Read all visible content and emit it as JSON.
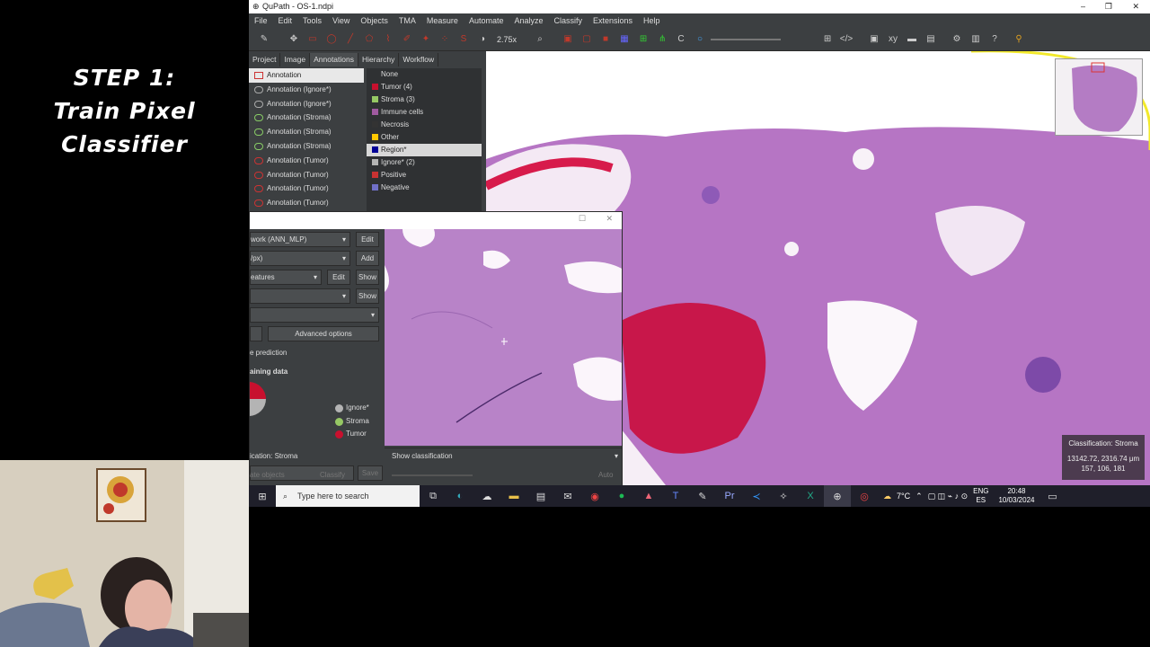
{
  "step": {
    "line1": "STEP 1:",
    "line2": "Train Pixel",
    "line3": "Classifier"
  },
  "window": {
    "title": "QuPath - OS-1.ndpi"
  },
  "menu": [
    "File",
    "Edit",
    "Tools",
    "View",
    "Objects",
    "TMA",
    "Measure",
    "Automate",
    "Analyze",
    "Classify",
    "Extensions",
    "Help"
  ],
  "toolbar": {
    "zoom": "2.75x"
  },
  "tabs": [
    "Project",
    "Image",
    "Annotations",
    "Hierarchy",
    "Workflow"
  ],
  "annotations": [
    "Annotation",
    "Annotation (Ignore*)",
    "Annotation (Ignore*)",
    "Annotation (Stroma)",
    "Annotation (Stroma)",
    "Annotation (Stroma)",
    "Annotation (Tumor)",
    "Annotation (Tumor)",
    "Annotation (Tumor)",
    "Annotation (Tumor)"
  ],
  "classes": [
    {
      "label": "None",
      "color": ""
    },
    {
      "label": "Tumor (4)",
      "color": "#c8102e"
    },
    {
      "label": "Stroma (3)",
      "color": "#96c864"
    },
    {
      "label": "Immune cells",
      "color": "#a05aa0"
    },
    {
      "label": "Necrosis",
      "color": "#333333"
    },
    {
      "label": "Other",
      "color": "#ffc800"
    },
    {
      "label": "Region*",
      "color": "#000096"
    },
    {
      "label": "Ignore* (2)",
      "color": "#b4b4b4"
    },
    {
      "label": "Positive",
      "color": "#c83232"
    },
    {
      "label": "Negative",
      "color": "#7070c8"
    }
  ],
  "viewer": {
    "classification": "Classification: Stroma",
    "coords": "13142.72, 2316.74 μm",
    "rgb": "157, 106, 181"
  },
  "dialog": {
    "classifier": "work (ANN_MLP)",
    "edit1": "Edit",
    "resolution": "/px)",
    "add": "Add",
    "features": "eatures",
    "edit2": "Edit",
    "show1": "Show",
    "show2": "Show",
    "advanced": "Advanced options",
    "live": "e prediction",
    "training": "aining data",
    "legend": [
      {
        "label": "Ignore*",
        "color": "#b4b4b4"
      },
      {
        "label": "Stroma",
        "color": "#96c864"
      },
      {
        "label": "Tumor",
        "color": "#c8102e"
      }
    ],
    "classification": "ication: Stroma",
    "save": "Save",
    "objects": "ate objects",
    "classify": "Classify",
    "auto": "Auto",
    "show_classification": "Show classification"
  },
  "taskbar": {
    "search_placeholder": "Type here to search",
    "weather": "7°C",
    "lang1": "ENG",
    "lang2": "ES",
    "time": "20:48",
    "date": "10/03/2024"
  }
}
